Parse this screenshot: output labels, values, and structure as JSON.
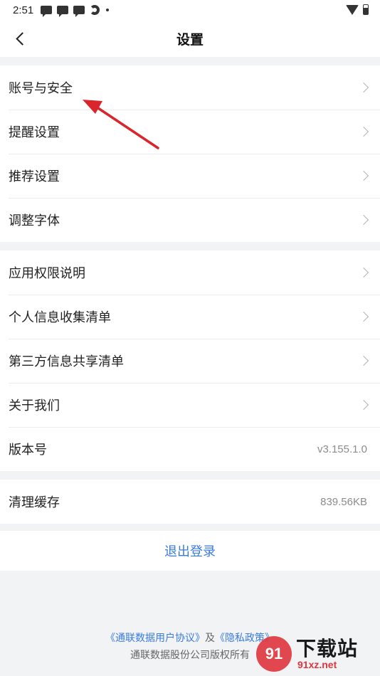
{
  "status_bar": {
    "time": "2:51",
    "icons": [
      "message-icon",
      "message-icon",
      "message-icon",
      "sync-icon",
      "dot-icon",
      "wifi-icon",
      "battery-icon"
    ]
  },
  "nav": {
    "title": "设置",
    "back_icon": "chevron-left-icon"
  },
  "group1": [
    {
      "label": "账号与安全"
    },
    {
      "label": "提醒设置"
    },
    {
      "label": "推荐设置"
    },
    {
      "label": "调整字体"
    }
  ],
  "group2": [
    {
      "label": "应用权限说明"
    },
    {
      "label": "个人信息收集清单"
    },
    {
      "label": "第三方信息共享清单"
    },
    {
      "label": "关于我们"
    },
    {
      "label": "版本号",
      "value": "v3.155.1.0"
    }
  ],
  "group3": [
    {
      "label": "清理缓存",
      "value": "839.56KB"
    }
  ],
  "logout": {
    "label": "退出登录"
  },
  "footer": {
    "user_agreement": "《通联数据用户协议》",
    "and": "及",
    "privacy_policy": "《隐私政策》",
    "copyright": "通联数据股份公司版权所有"
  },
  "watermark": {
    "logo_text": "91",
    "title": "下载站",
    "url": "91xz.net"
  },
  "colors": {
    "accent": "#3a7be0",
    "annotation_arrow": "#d9252b",
    "background": "#f2f3f5"
  }
}
